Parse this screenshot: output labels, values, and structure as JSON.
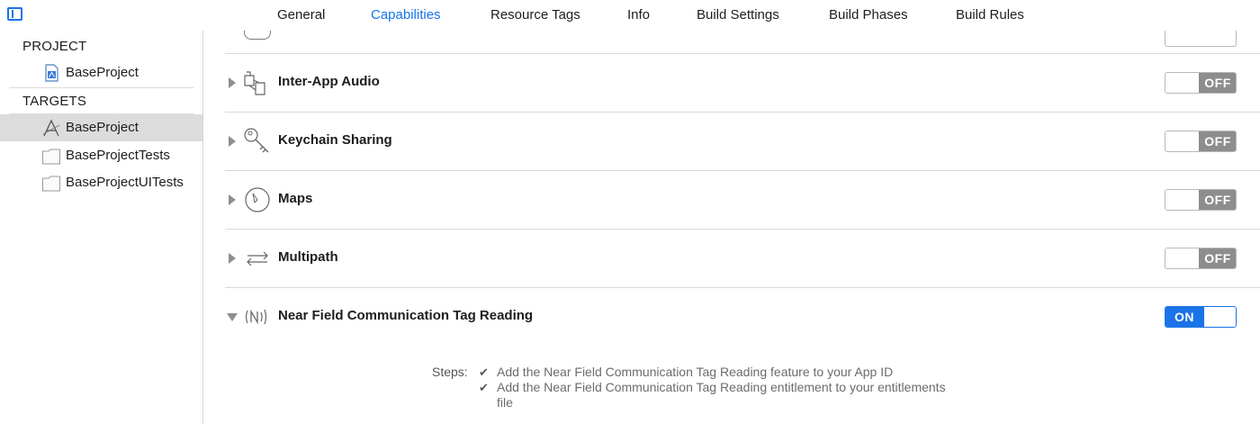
{
  "tabs": [
    {
      "label": "General",
      "active": false
    },
    {
      "label": "Capabilities",
      "active": true
    },
    {
      "label": "Resource Tags",
      "active": false
    },
    {
      "label": "Info",
      "active": false
    },
    {
      "label": "Build Settings",
      "active": false
    },
    {
      "label": "Build Phases",
      "active": false
    },
    {
      "label": "Build Rules",
      "active": false
    }
  ],
  "sidebar": {
    "project_header": "PROJECT",
    "project_items": [
      {
        "label": "BaseProject",
        "icon": "project-file-icon"
      }
    ],
    "targets_header": "TARGETS",
    "target_items": [
      {
        "label": "BaseProject",
        "icon": "app-target-icon",
        "selected": true
      },
      {
        "label": "BaseProjectTests",
        "icon": "test-bundle-icon",
        "selected": false
      },
      {
        "label": "BaseProjectUITests",
        "icon": "test-bundle-icon",
        "selected": false
      }
    ]
  },
  "capabilities": [
    {
      "title": "Inter-App Audio",
      "icon": "inter-app-audio-icon",
      "state": "OFF",
      "expanded": false
    },
    {
      "title": "Keychain Sharing",
      "icon": "keychain-icon",
      "state": "OFF",
      "expanded": false
    },
    {
      "title": "Maps",
      "icon": "maps-compass-icon",
      "state": "OFF",
      "expanded": false
    },
    {
      "title": "Multipath",
      "icon": "multipath-icon",
      "state": "OFF",
      "expanded": false
    },
    {
      "title": "Near Field Communication Tag Reading",
      "icon": "nfc-icon",
      "state": "ON",
      "expanded": true
    }
  ],
  "nfc_steps": {
    "label": "Steps:",
    "items": [
      "Add the Near Field Communication Tag Reading feature to your App ID",
      "Add the Near Field Communication Tag Reading entitlement to your entitlements file"
    ]
  },
  "colors": {
    "accent": "#1a73e8",
    "off_state": "#8d8d8d",
    "selected_row": "#dcdcdc"
  }
}
